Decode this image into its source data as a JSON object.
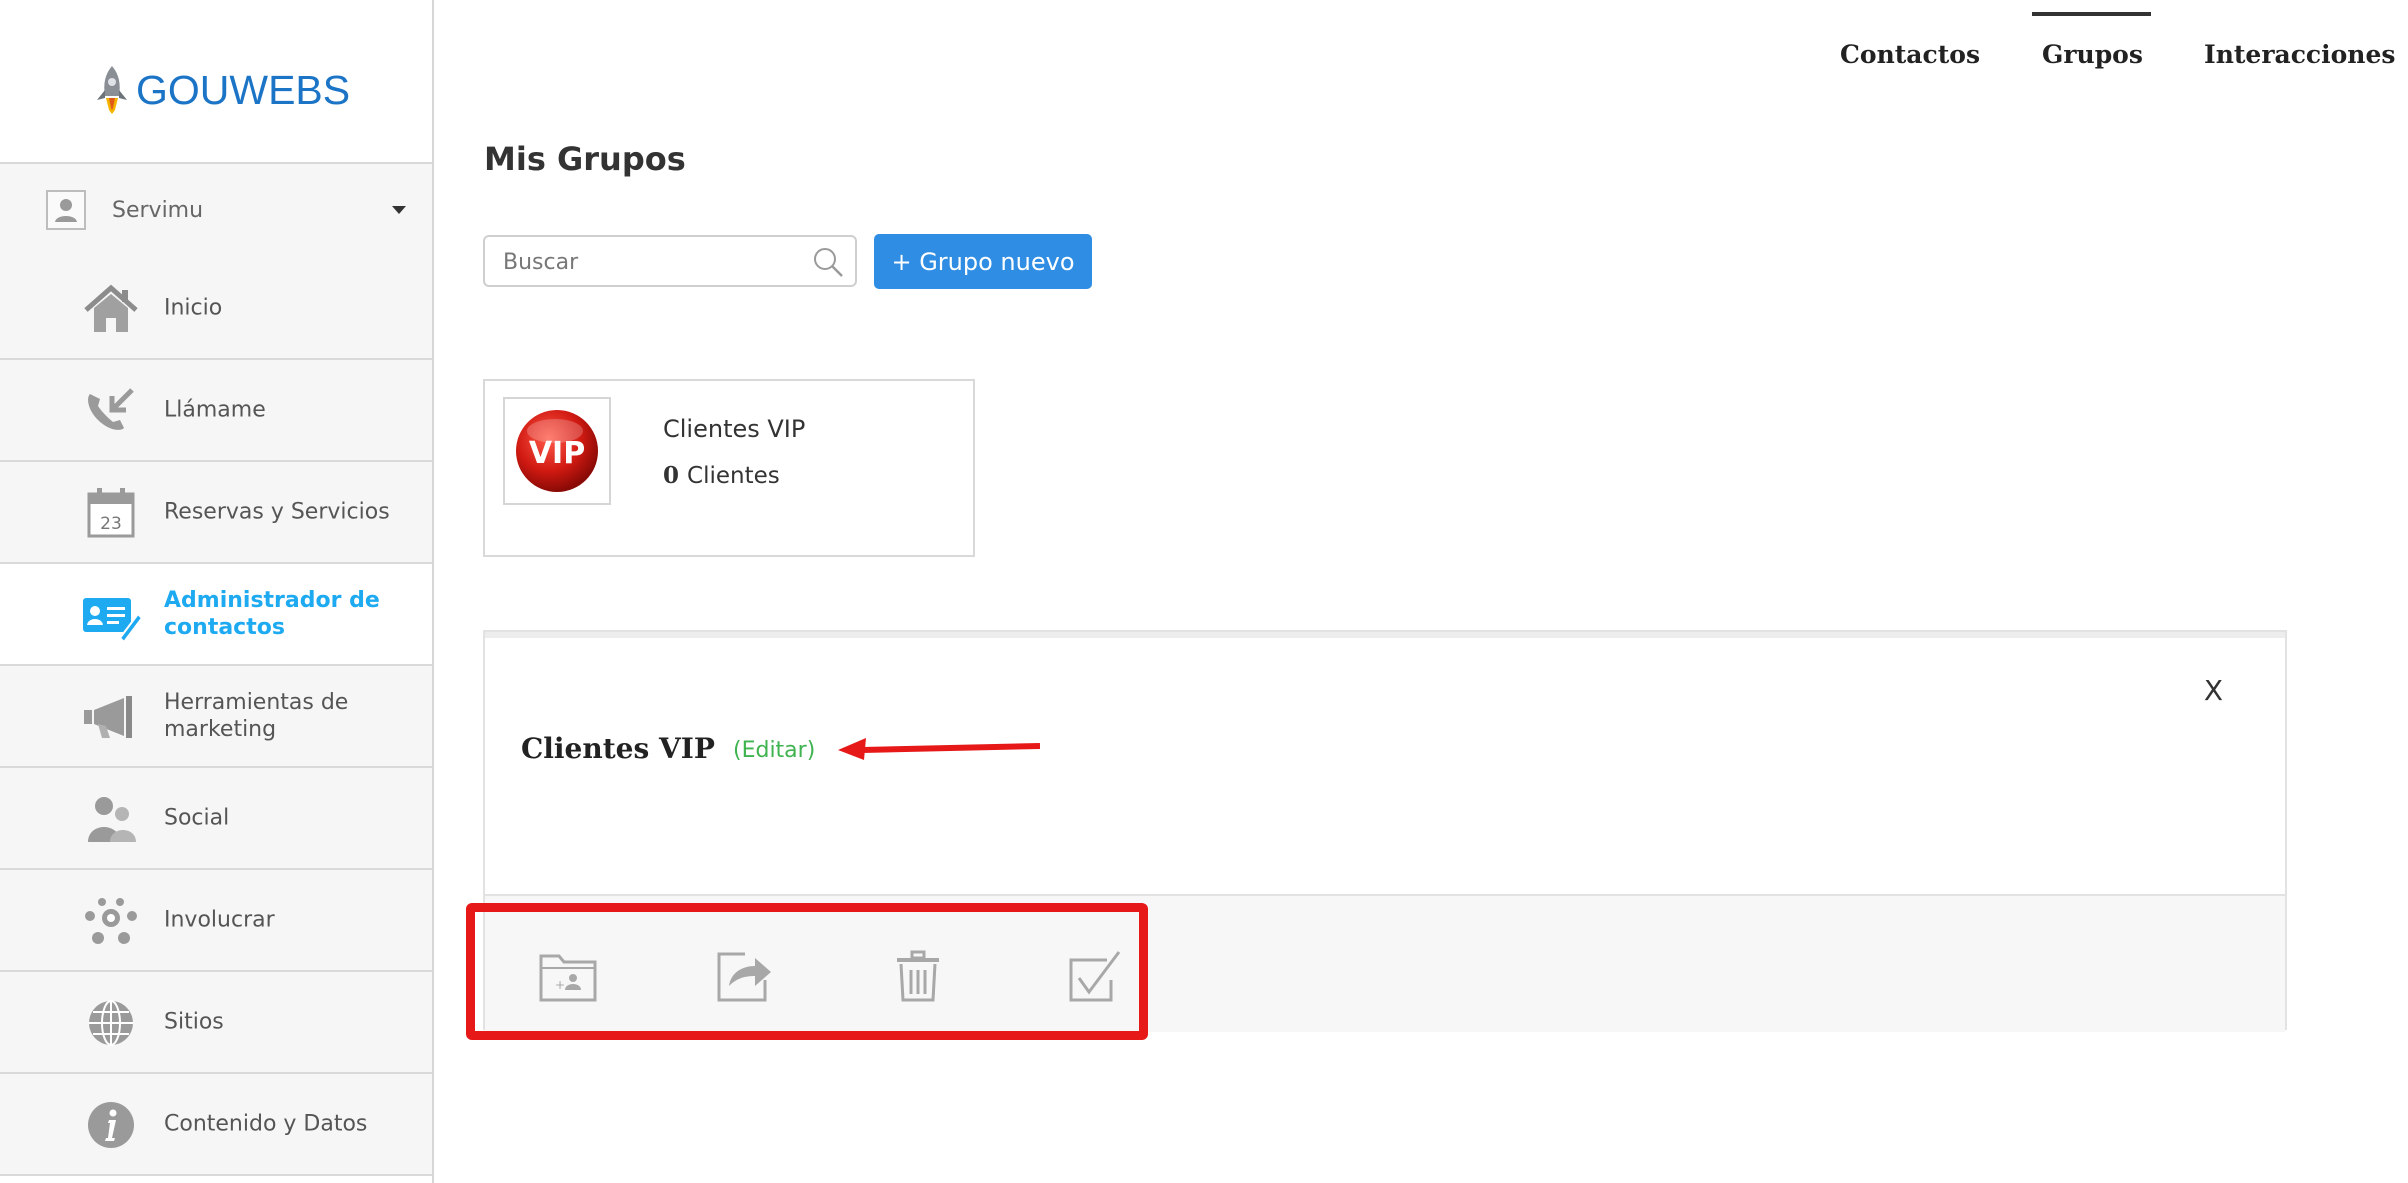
{
  "brand": {
    "name": "GOUWEBS"
  },
  "account": {
    "name": "Servimu"
  },
  "sidebar": {
    "items": [
      {
        "label": "Inicio",
        "icon": "home-icon"
      },
      {
        "label": "Llámame",
        "icon": "phone-callback-icon"
      },
      {
        "label": "Reservas y Servicios",
        "icon": "calendar-icon"
      },
      {
        "label": "Administrador de contactos",
        "icon": "contact-card-icon",
        "active": true
      },
      {
        "label": "Herramientas de marketing",
        "icon": "megaphone-icon"
      },
      {
        "label": "Social",
        "icon": "people-icon"
      },
      {
        "label": "Involucrar",
        "icon": "network-icon"
      },
      {
        "label": "Sitios",
        "icon": "globe-icon"
      },
      {
        "label": "Contenido y Datos",
        "icon": "info-icon"
      }
    ]
  },
  "topnav": {
    "tabs": [
      {
        "label": "Contactos",
        "active": false
      },
      {
        "label": "Grupos",
        "active": true
      },
      {
        "label": "Interacciones",
        "active": false
      }
    ]
  },
  "main": {
    "title": "Mis Grupos",
    "search_placeholder": "Buscar",
    "new_group_label": "+ Grupo nuevo"
  },
  "group_card": {
    "badge_text": "VIP",
    "name": "Clientes VIP",
    "count": "0",
    "count_label": "Clientes"
  },
  "detail": {
    "title": "Clientes VIP",
    "edit_label": "(Editar)",
    "close_label": "X",
    "toolbar": [
      "add-contact-folder-icon",
      "share-export-icon",
      "trash-icon",
      "checkbox-select-icon"
    ]
  },
  "colors": {
    "accent": "#2f8de4",
    "active_nav": "#1eaaf1",
    "edit_link": "#3fb34f",
    "annotation_red": "#e61818"
  }
}
